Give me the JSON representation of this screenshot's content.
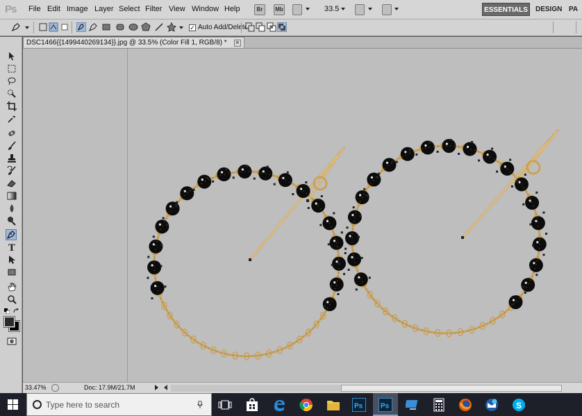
{
  "app": {
    "logo": "Ps",
    "menus": [
      "File",
      "Edit",
      "Image",
      "Layer",
      "Select",
      "Filter",
      "View",
      "Window",
      "Help"
    ],
    "mini_buttons": [
      "Br",
      "Mb"
    ],
    "zoom_display": "33.5",
    "workspaces": {
      "active": "ESSENTIALS",
      "design": "DESIGN",
      "more": "PA"
    }
  },
  "options_bar": {
    "auto_add_delete_label": "Auto Add/Delete",
    "auto_add_delete_checked": true
  },
  "document": {
    "tab_title": "DSC1466{{1499440269134}}.jpg @ 33.5% (Color Fill 1, RGB/8) *",
    "close_symbol": "✕"
  },
  "status_bar": {
    "zoom": "33.47%",
    "doc_info": "Doc: 17.9M/21.7M"
  },
  "taskbar": {
    "search_placeholder": "Type here to search",
    "apps": [
      "task-view",
      "store",
      "edge",
      "chrome",
      "file-explorer",
      "photoshop",
      "photoshop-active",
      "remote-desktop",
      "calculator",
      "firefox",
      "outlook",
      "skype"
    ]
  },
  "colors": {
    "canvas": "#bebebe",
    "gold": "#c9a15a",
    "bead": "#0c0c0c",
    "active_tool": "#9fb8d8"
  }
}
